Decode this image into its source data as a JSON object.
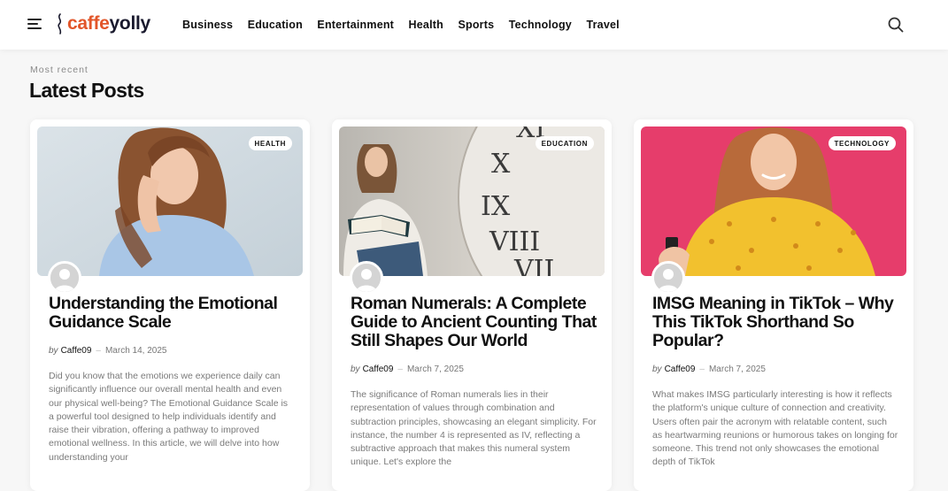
{
  "header": {
    "logo": {
      "part1": "caffe",
      "part2": "yolly"
    },
    "nav": [
      "Business",
      "Education",
      "Entertainment",
      "Health",
      "Sports",
      "Technology",
      "Travel"
    ]
  },
  "section": {
    "eyebrow": "Most recent",
    "title": "Latest Posts"
  },
  "posts": [
    {
      "category": "HEALTH",
      "title": "Understanding the Emotional Guidance Scale",
      "by": "by",
      "author": "Caffe09",
      "date": "March 14, 2025",
      "excerpt": "Did you know that the emotions we experience daily can significantly influence our overall mental health and even our physical well-being? The Emotional Guidance Scale is a powerful tool designed to help individuals identify and raise their vibration, offering a pathway to improved emotional wellness. In this article, we will delve into how understanding your"
    },
    {
      "category": "EDUCATION",
      "title": "Roman Numerals: A Complete Guide to Ancient Counting That Still Shapes Our World",
      "by": "by",
      "author": "Caffe09",
      "date": "March 7, 2025",
      "excerpt": "The significance of Roman numerals lies in their representation of values through combination and subtraction principles, showcasing an elegant simplicity. For instance, the number 4 is represented as IV, reflecting a subtractive approach that makes this numeral system unique. Let's explore the"
    },
    {
      "category": "TECHNOLOGY",
      "title": "IMSG Meaning in TikTok – Why This TikTok Shorthand So Popular?",
      "by": "by",
      "author": "Caffe09",
      "date": "March 7, 2025",
      "excerpt": "What makes IMSG particularly interesting is how it reflects the platform's unique culture of connection and creativity. Users often pair the acronym with relatable content, such as heartwarming reunions or humorous takes on longing for someone. This trend not only showcases the emotional depth of TikTok"
    }
  ],
  "media_art": {
    "post1": {
      "numerals": []
    },
    "post2": {
      "numerals": [
        "XI",
        "X",
        "IX",
        "VIII",
        "VII"
      ]
    }
  },
  "colors": {
    "brand_orange": "#e2562a",
    "brand_dark": "#1a1a2e",
    "pink_backdrop": "#e63d6b",
    "excerpt_gray": "#7a7a7a"
  },
  "icons": [
    "menu-icon",
    "search-icon",
    "avatar-placeholder-icon"
  ]
}
